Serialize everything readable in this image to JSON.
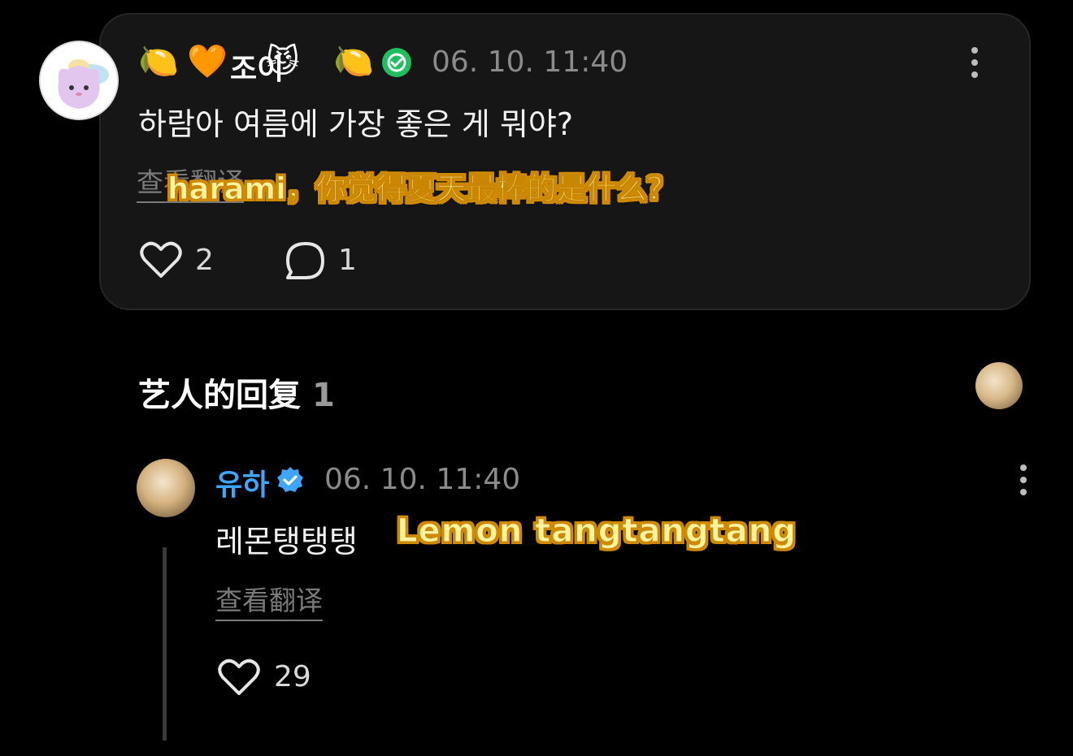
{
  "comment": {
    "emojis_before": [
      "🍋",
      "🧡"
    ],
    "author": "조이",
    "emojis_after": [
      "😼",
      "🍋"
    ],
    "timestamp": "06. 10. 11:40",
    "text": "하람아 여름에 가장 좋은 게 뭐야?",
    "translate_link": "查看翻译",
    "subtitle": "harami，你觉得夏天最棒的是什么？",
    "likes": "2",
    "replies": "1",
    "badge_color": "#1fbf5f"
  },
  "artist_replies": {
    "title": "艺人的回复",
    "count": "1"
  },
  "reply": {
    "author": "유하",
    "timestamp": "06. 10. 11:40",
    "text": "레몬탱탱탱",
    "subtitle": "Lemon tangtangtang",
    "translate_link": "查看翻译",
    "likes": "29",
    "name_color": "#3fa6ff"
  }
}
